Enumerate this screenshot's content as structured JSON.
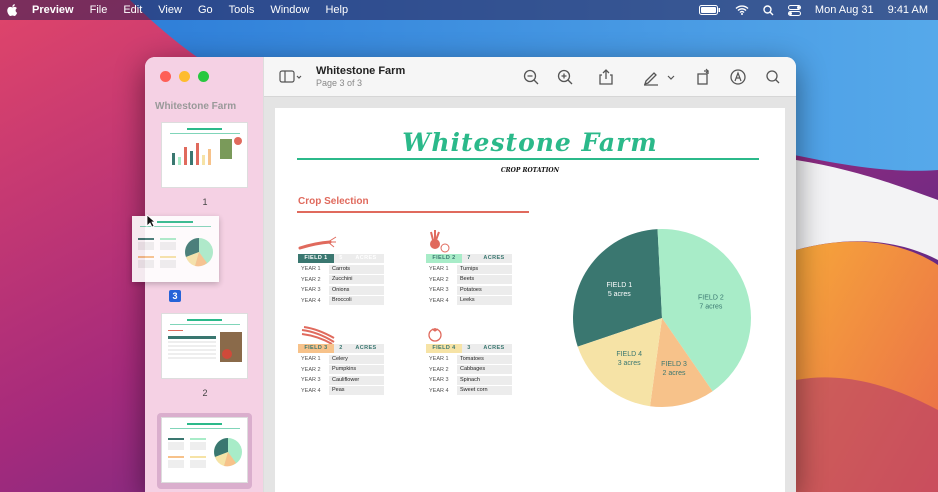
{
  "menubar": {
    "app": "Preview",
    "items": [
      "File",
      "Edit",
      "View",
      "Go",
      "Tools",
      "Window",
      "Help"
    ],
    "date": "Mon Aug 31",
    "time": "9:41 AM"
  },
  "window": {
    "title": "Whitestone Farm",
    "subtitle": "Page 3 of 3"
  },
  "sidebar": {
    "title": "Whitestone Farm",
    "thumbs": [
      {
        "number": "1"
      },
      {
        "number": "2"
      }
    ],
    "drag_badge": "3"
  },
  "document": {
    "title": "Whitestone Farm",
    "subtitle": "CROP ROTATION",
    "section": "Crop Selection",
    "acres_label": "ACRES",
    "fields": [
      {
        "name": "FIELD 1",
        "acres": "5",
        "color": "#3a7770",
        "text": "#ffffff",
        "rows": [
          [
            "YEAR 1",
            "Carrots"
          ],
          [
            "YEAR 2",
            "Zucchini"
          ],
          [
            "YEAR 3",
            "Onions"
          ],
          [
            "YEAR 4",
            "Broccoli"
          ]
        ]
      },
      {
        "name": "FIELD 2",
        "acres": "7",
        "color": "#a8ecc8",
        "text": "#3a7770",
        "rows": [
          [
            "YEAR 1",
            "Turnips"
          ],
          [
            "YEAR 2",
            "Beets"
          ],
          [
            "YEAR 3",
            "Potatoes"
          ],
          [
            "YEAR 4",
            "Leeks"
          ]
        ]
      },
      {
        "name": "FIELD 3",
        "acres": "2",
        "color": "#f7c28a",
        "text": "#3a7770",
        "rows": [
          [
            "YEAR 1",
            "Celery"
          ],
          [
            "YEAR 2",
            "Pumpkins"
          ],
          [
            "YEAR 3",
            "Cauliflower"
          ],
          [
            "YEAR 4",
            "Peas"
          ]
        ]
      },
      {
        "name": "FIELD 4",
        "acres": "3",
        "color": "#f6e3a6",
        "text": "#3a7770",
        "rows": [
          [
            "YEAR 1",
            "Tomatoes"
          ],
          [
            "YEAR 2",
            "Cabbages"
          ],
          [
            "YEAR 3",
            "Spinach"
          ],
          [
            "YEAR 4",
            "Sweet corn"
          ]
        ]
      }
    ]
  },
  "chart_data": {
    "type": "pie",
    "title": "",
    "slices": [
      {
        "label": "FIELD 1",
        "sub": "5 acres",
        "value": 5,
        "color": "#3a7770"
      },
      {
        "label": "FIELD 2",
        "sub": "7 acres",
        "value": 7,
        "color": "#a8ecc8"
      },
      {
        "label": "FIELD 3",
        "sub": "2 acres",
        "value": 2,
        "color": "#f7c28a"
      },
      {
        "label": "FIELD 4",
        "sub": "3 acres",
        "value": 3,
        "color": "#f6e3a6"
      }
    ]
  },
  "colors": {
    "accent": "#2bb98a",
    "section": "#e06a5d"
  }
}
